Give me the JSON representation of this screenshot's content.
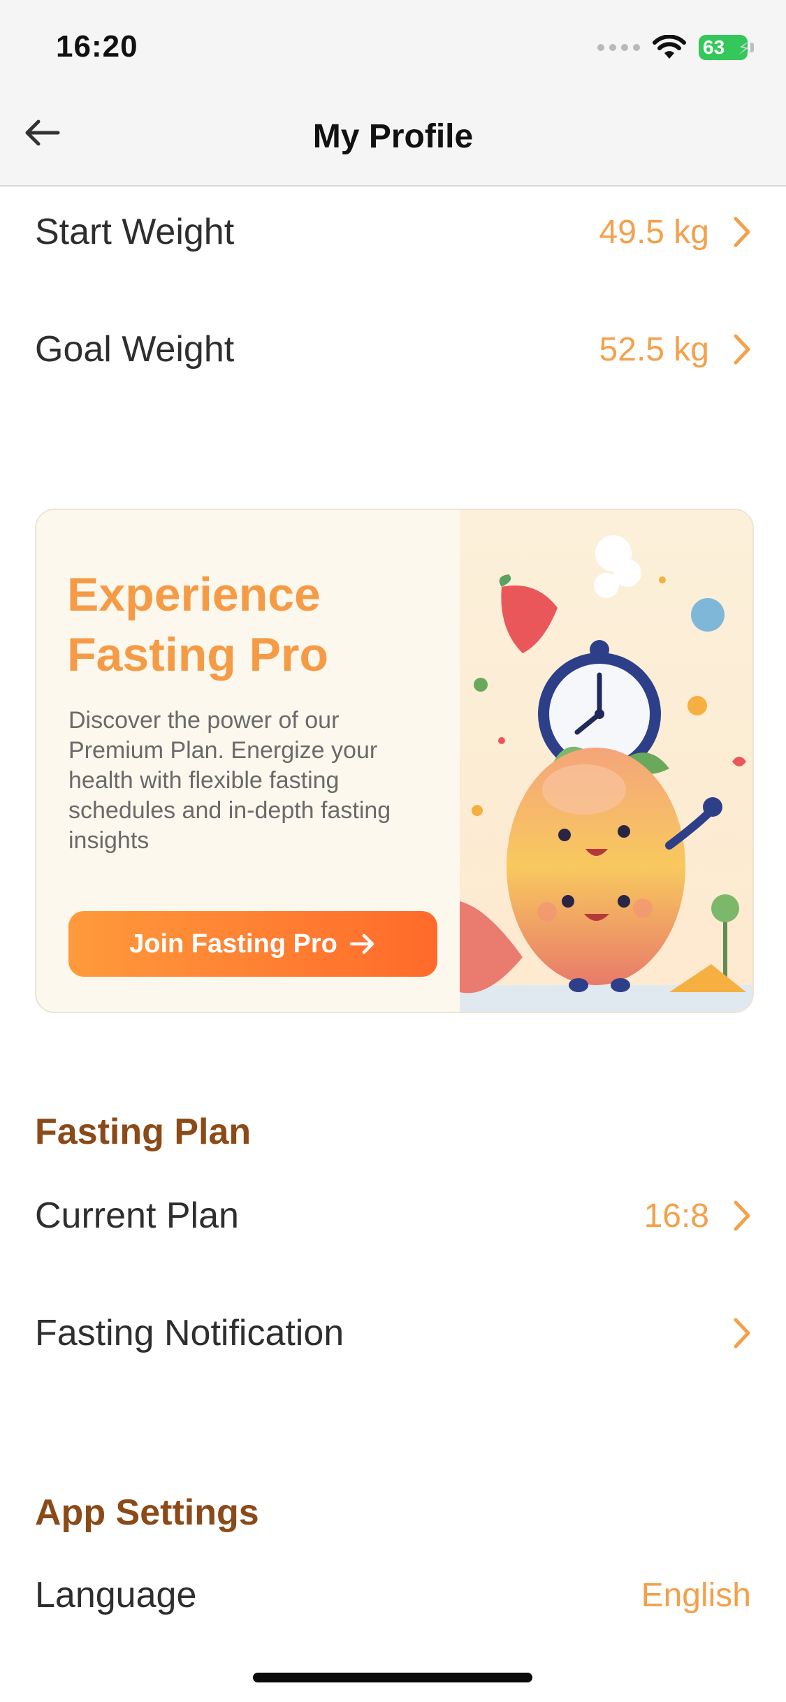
{
  "status_bar": {
    "time": "16:20",
    "battery": "63"
  },
  "header": {
    "title": "My Profile"
  },
  "profile_rows": [
    {
      "label": "Start Weight",
      "value": "49.5 kg"
    },
    {
      "label": "Goal Weight",
      "value": "52.5 kg"
    }
  ],
  "promo": {
    "title_line1": "Experience",
    "title_line2": "Fasting Pro",
    "description": "Discover the power of our Premium Plan. Energize your health with flexible fasting schedules and in-depth fasting insights",
    "button_label": "Join Fasting Pro"
  },
  "fasting_plan": {
    "section_title": "Fasting Plan",
    "rows": [
      {
        "label": "Current Plan",
        "value": "16:8"
      },
      {
        "label": "Fasting Notification",
        "value": ""
      }
    ]
  },
  "app_settings": {
    "section_title": "App Settings",
    "rows": [
      {
        "label": "Language",
        "value": "English"
      }
    ]
  },
  "colors": {
    "accent": "#f5a04a",
    "section": "#8b4a17",
    "button_start": "#ff9a3c",
    "button_end": "#ff6a2a"
  }
}
